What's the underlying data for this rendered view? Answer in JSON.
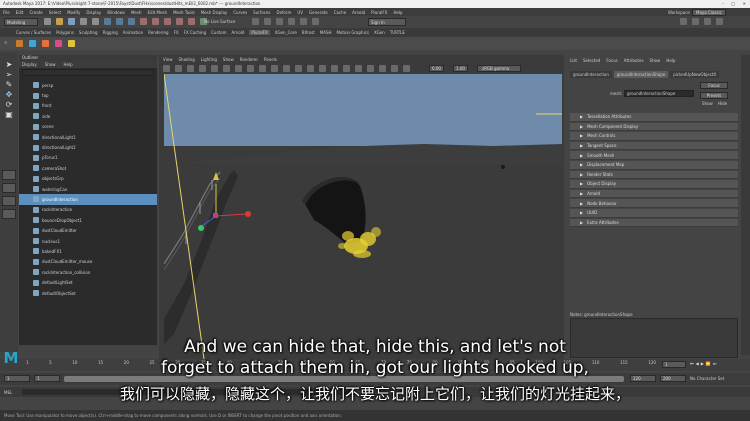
{
  "window": {
    "title": "Autodesk Maya 2017: E:\\Video\\Pluralsight 7-stone\\F-2015\\Fayst\\Dust\\FHx\\scenes\\dustHits_mEll2_6002.mb* --- groundInteraction"
  },
  "menubar": {
    "items": [
      "File",
      "Edit",
      "Create",
      "Select",
      "Modify",
      "Display",
      "Windows",
      "Mesh",
      "Edit Mesh",
      "Mesh Tools",
      "Mesh Display",
      "Curves",
      "Surfaces",
      "Deform",
      "UV",
      "Generate",
      "Cache",
      "Arnold",
      "PluralFX",
      "Help"
    ],
    "workspace_label": "Workspace",
    "workspace_value": "Maya Classic"
  },
  "statusline": {
    "mode": "Modeling",
    "live_surface": "No Live Surface",
    "sign_in": "Sign In"
  },
  "shelf": {
    "tabs": [
      "Curves / Surfaces",
      "Polygons",
      "Sculpting",
      "Rigging",
      "Animation",
      "Rendering",
      "FX",
      "FX Caching",
      "Custom",
      "Arnold",
      "PluralFX",
      "XGen_Core",
      "Bifrost",
      "MASH",
      "Motion Graphics",
      "XGen",
      "TURTLE"
    ],
    "active_tab": "PluralFX"
  },
  "outliner": {
    "title": "Outliner",
    "menu": [
      "Display",
      "Show",
      "Help"
    ],
    "items": [
      {
        "label": "persp",
        "selected": false
      },
      {
        "label": "top",
        "selected": false
      },
      {
        "label": "front",
        "selected": false
      },
      {
        "label": "side",
        "selected": false
      },
      {
        "label": "scene",
        "selected": false
      },
      {
        "label": "directionalLight1",
        "selected": false
      },
      {
        "label": "directionalLight2",
        "selected": false
      },
      {
        "label": "pTorus1",
        "selected": false
      },
      {
        "label": "cameraShot",
        "selected": false
      },
      {
        "label": "objectsGrp",
        "selected": false
      },
      {
        "label": "wateringCan",
        "selected": false
      },
      {
        "label": "groundInteraction",
        "selected": true
      },
      {
        "label": "rockInteraction",
        "selected": false
      },
      {
        "label": "bounceDropObject1",
        "selected": false
      },
      {
        "label": "dustCloudEmitter",
        "selected": false
      },
      {
        "label": "nucleus1",
        "selected": false
      },
      {
        "label": "bakedFX1",
        "selected": false
      },
      {
        "label": "dustCloudEmitter_mouse",
        "selected": false
      },
      {
        "label": "rockInteraction_collision",
        "selected": false
      },
      {
        "label": "defaultLightSet",
        "selected": false
      },
      {
        "label": "defaultObjectSet",
        "selected": false
      }
    ]
  },
  "viewport": {
    "menu": [
      "View",
      "Shading",
      "Lighting",
      "Show",
      "Renderer",
      "Panels"
    ],
    "exposure": "0.00",
    "gamma": "1.00",
    "color_space": "sRGB gamma",
    "camera_label": "persp",
    "sky_color": "#6f8bab",
    "ground_color": "#3a3a3a"
  },
  "attribute_editor": {
    "menu": [
      "List",
      "Selected",
      "Focus",
      "Attributes",
      "Show",
      "Help"
    ],
    "tabs": [
      "groundInteraction",
      "groundInteractionShape",
      "pickedUpNewObject0"
    ],
    "node_label": "mesh:",
    "node_value": "groundInteractionShape",
    "focus_button": "Focus",
    "presets_button": "Presets",
    "show_button": "Show",
    "hide_button": "Hide",
    "sections": [
      "Tessellation Attributes",
      "Mesh Component Display",
      "Mesh Controls",
      "Tangent Space",
      "Smooth Mesh",
      "Displacement Map",
      "Render Stats",
      "Object Display",
      "Arnold",
      "Node Behavior",
      "UUID",
      "Extra Attributes"
    ],
    "notes_label": "Notes:  groundInteractionShape",
    "select_button": "Select",
    "load_attributes_button": "Load Attributes",
    "copy_tab_button": "Copy Tab"
  },
  "timeline": {
    "ticks": [
      "1",
      "5",
      "10",
      "15",
      "20",
      "25",
      "30",
      "35",
      "40",
      "45",
      "50",
      "55",
      "60",
      "65",
      "70",
      "75",
      "80",
      "85",
      "90",
      "95",
      "100",
      "105",
      "110",
      "115",
      "120"
    ],
    "current_frame": "1"
  },
  "range": {
    "start": "1",
    "range_start": "1",
    "range_end": "120",
    "end": "200",
    "anim_layer": "No Anim Layer",
    "char_set": "No Character Set"
  },
  "cmdline": {
    "label": "MEL"
  },
  "helpline": {
    "text": "Move Tool: Use manipulator to move object(s). Ctrl+middle-drag to move components along normals. Use D or INSERT to change the pivot position and axis orientation."
  },
  "subtitles": {
    "english_line1": "And we can hide that, hide this, and let's not",
    "english_line2": "forget to attach them in, got our lights hooked up,",
    "chinese": "我们可以隐藏，隐藏这个，让我们不要忘记附上它们，让我们的灯光挂起来，"
  },
  "logo": {
    "letter": "M"
  }
}
